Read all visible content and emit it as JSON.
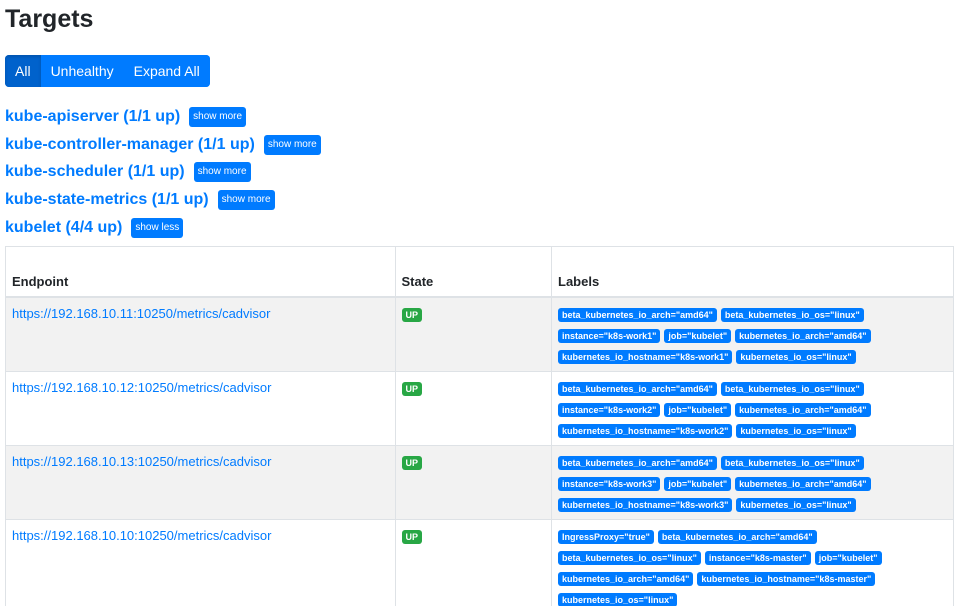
{
  "page": {
    "title": "Targets"
  },
  "filters": {
    "all_label": "All",
    "unhealthy_label": "Unhealthy",
    "expand_label": "Expand All"
  },
  "pools": [
    {
      "label": "kube-apiserver (1/1 up)",
      "toggle": "show more"
    },
    {
      "label": "kube-controller-manager (1/1 up)",
      "toggle": "show more"
    },
    {
      "label": "kube-scheduler (1/1 up)",
      "toggle": "show more"
    },
    {
      "label": "kube-state-metrics (1/1 up)",
      "toggle": "show more"
    },
    {
      "label": "kubelet (4/4 up)",
      "toggle": "show less"
    }
  ],
  "table": {
    "headers": {
      "endpoint": "Endpoint",
      "state": "State",
      "labels": "Labels"
    },
    "rows": [
      {
        "endpoint": "https://192.168.10.11:10250/metrics/cadvisor",
        "state": "UP",
        "labels": [
          "beta_kubernetes_io_arch=\"amd64\"",
          "beta_kubernetes_io_os=\"linux\"",
          "instance=\"k8s-work1\"",
          "job=\"kubelet\"",
          "kubernetes_io_arch=\"amd64\"",
          "kubernetes_io_hostname=\"k8s-work1\"",
          "kubernetes_io_os=\"linux\""
        ]
      },
      {
        "endpoint": "https://192.168.10.12:10250/metrics/cadvisor",
        "state": "UP",
        "labels": [
          "beta_kubernetes_io_arch=\"amd64\"",
          "beta_kubernetes_io_os=\"linux\"",
          "instance=\"k8s-work2\"",
          "job=\"kubelet\"",
          "kubernetes_io_arch=\"amd64\"",
          "kubernetes_io_hostname=\"k8s-work2\"",
          "kubernetes_io_os=\"linux\""
        ]
      },
      {
        "endpoint": "https://192.168.10.13:10250/metrics/cadvisor",
        "state": "UP",
        "labels": [
          "beta_kubernetes_io_arch=\"amd64\"",
          "beta_kubernetes_io_os=\"linux\"",
          "instance=\"k8s-work3\"",
          "job=\"kubelet\"",
          "kubernetes_io_arch=\"amd64\"",
          "kubernetes_io_hostname=\"k8s-work3\"",
          "kubernetes_io_os=\"linux\""
        ]
      },
      {
        "endpoint": "https://192.168.10.10:10250/metrics/cadvisor",
        "state": "UP",
        "labels": [
          "IngressProxy=\"true\"",
          "beta_kubernetes_io_arch=\"amd64\"",
          "beta_kubernetes_io_os=\"linux\"",
          "instance=\"k8s-master\"",
          "job=\"kubelet\"",
          "kubernetes_io_arch=\"amd64\"",
          "kubernetes_io_hostname=\"k8s-master\"",
          "kubernetes_io_os=\"linux\""
        ]
      }
    ]
  },
  "colors": {
    "primary": "#007bff",
    "primary_active": "#0062cc",
    "success": "#28a745",
    "stripe": "#f2f2f2",
    "border": "#dee2e6"
  }
}
